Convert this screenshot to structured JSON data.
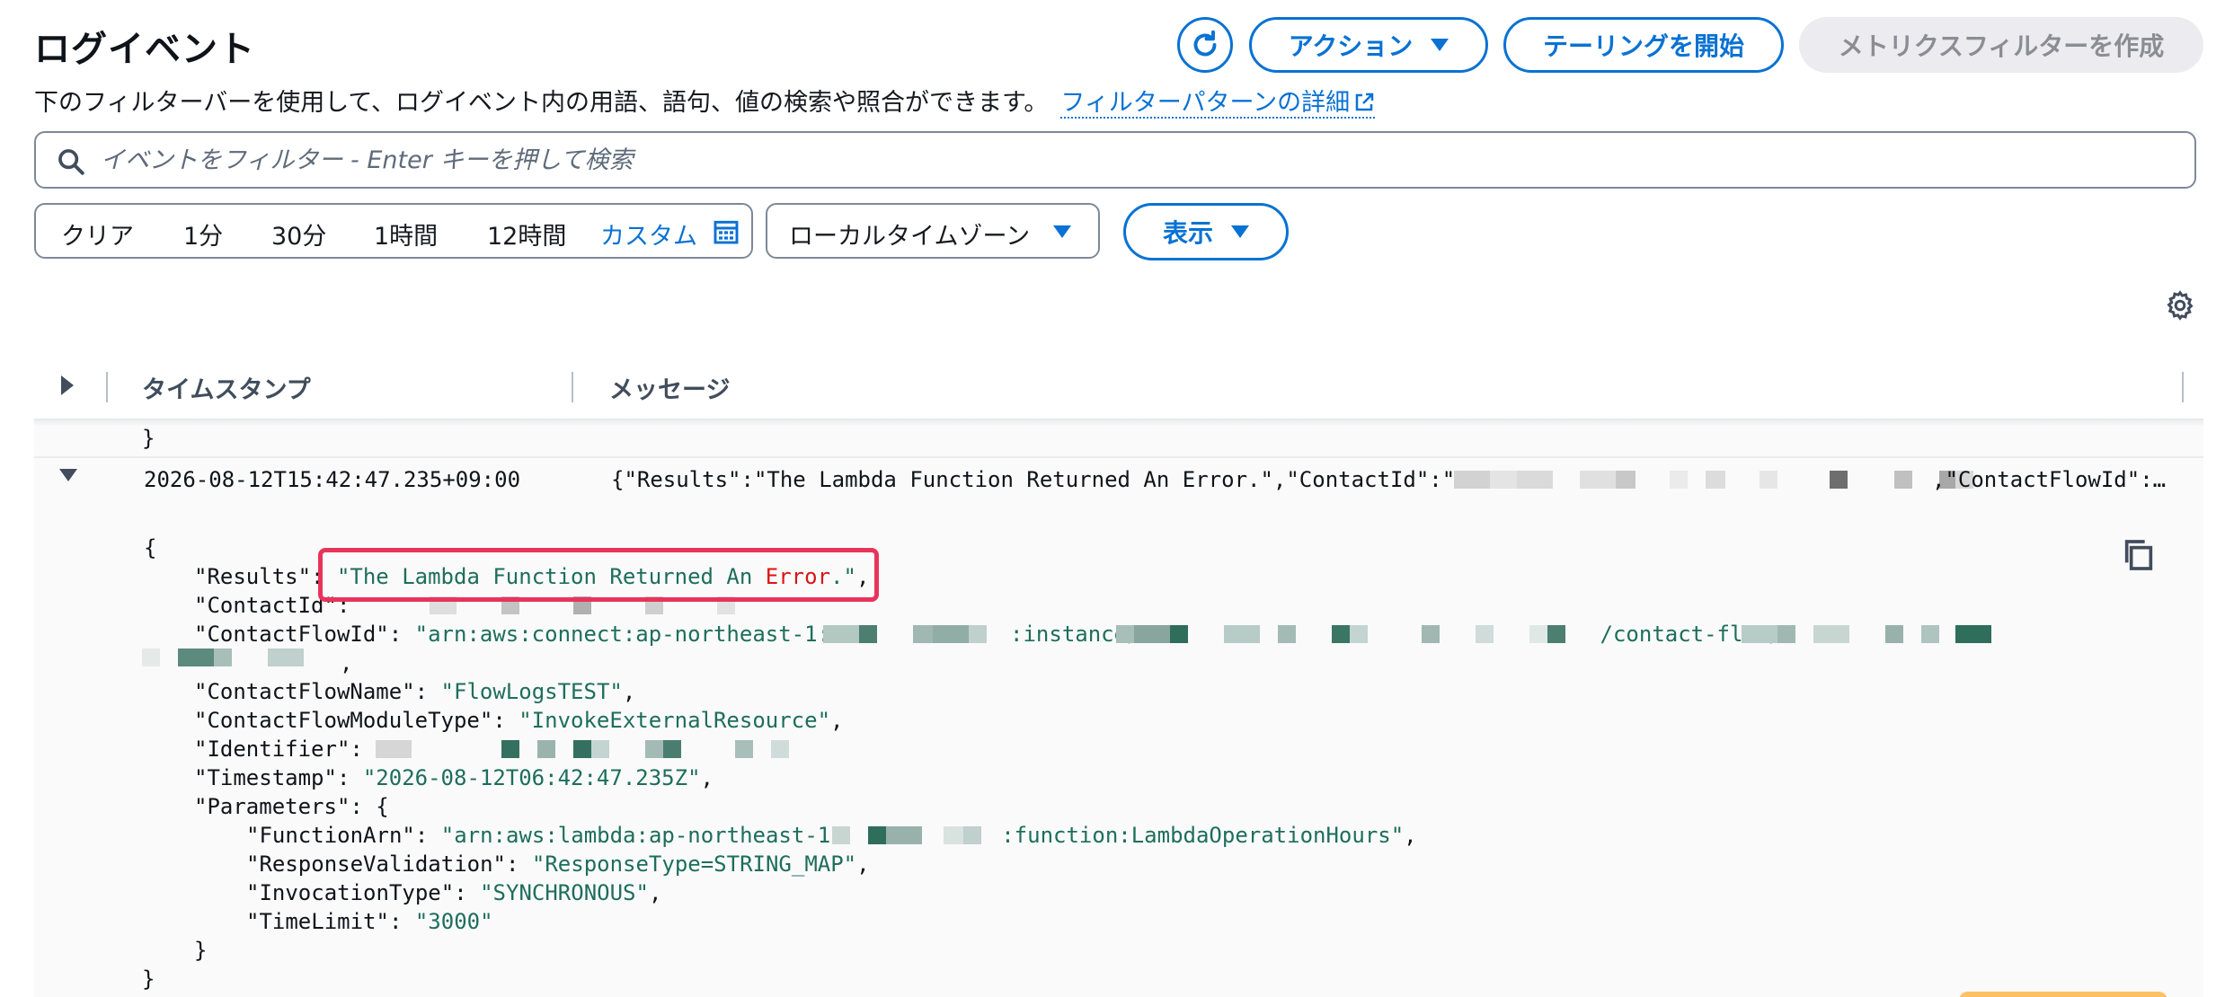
{
  "header": {
    "title": "ログイベント",
    "description": "下のフィルターバーを使用して、ログイベント内の用語、語句、値の検索や照合ができます。",
    "filter_link": "フィルターパターンの詳細",
    "actions_label": "アクション",
    "tail_label": "テーリングを開始",
    "metric_filter_label": "メトリクスフィルターを作成"
  },
  "search": {
    "placeholder": "イベントをフィルター - Enter キーを押して検索"
  },
  "time_range": {
    "clear": "クリア",
    "options": [
      "1分",
      "30分",
      "1時間",
      "12時間"
    ],
    "custom": "カスタム"
  },
  "timezone": {
    "selected": "ローカルタイムゾーン"
  },
  "view": {
    "label": "表示"
  },
  "table": {
    "columns": [
      "タイムスタンプ",
      "メッセージ"
    ],
    "prev_row_tail": "}",
    "row": {
      "timestamp": "2026-08-12T15:42:47.235+09:00",
      "message_start": "{\"Results\":\"The Lambda Function Returned An Error.\",\"ContactId\":\"",
      "message_end": ",\"ContactFlowId\":…"
    }
  },
  "json": {
    "open_brace": "{",
    "results_key": "\"Results\": ",
    "results_value_prefix": "\"The Lambda Function Returned An ",
    "results_value_error": "Error",
    "results_value_suffix": ".\"",
    "comma": ",",
    "contact_id_key": "\"ContactId\": ",
    "contact_flow_id_key": "\"ContactFlowId\": ",
    "contact_flow_id_p1": "\"arn:aws:connect:ap-northeast-1:",
    "contact_flow_id_p2": ":instance/",
    "contact_flow_id_p3": "/contact-flow/",
    "contact_flow_name_key": "\"ContactFlowName\": ",
    "contact_flow_name_value": "\"FlowLogsTEST\"",
    "module_type_key": "\"ContactFlowModuleType\": ",
    "module_type_value": "\"InvokeExternalResource\"",
    "identifier_key": "\"Identifier\": ",
    "timestamp_key": "\"Timestamp\": ",
    "timestamp_value": "\"2026-08-12T06:42:47.235Z\"",
    "parameters_key": "\"Parameters\": {",
    "function_arn_key": "\"FunctionArn\": ",
    "function_arn_p1": "\"arn:aws:lambda:ap-northeast-1",
    "function_arn_p2": ":function:LambdaOperationHours\"",
    "response_validation_key": "\"ResponseValidation\": ",
    "response_validation_value": "\"ResponseType=STRING_MAP\"",
    "invocation_type_key": "\"InvocationType\": ",
    "invocation_type_value": "\"SYNCHRONOUS\"",
    "time_limit_key": "\"TimeLimit\": ",
    "time_limit_value": "\"3000\"",
    "inner_close": "}",
    "outer_close": "}"
  },
  "colors": {
    "accent": "#0972d3",
    "json_string": "#1d6e5b",
    "error_text": "#d91515",
    "highlight_border": "#e8345a"
  }
}
